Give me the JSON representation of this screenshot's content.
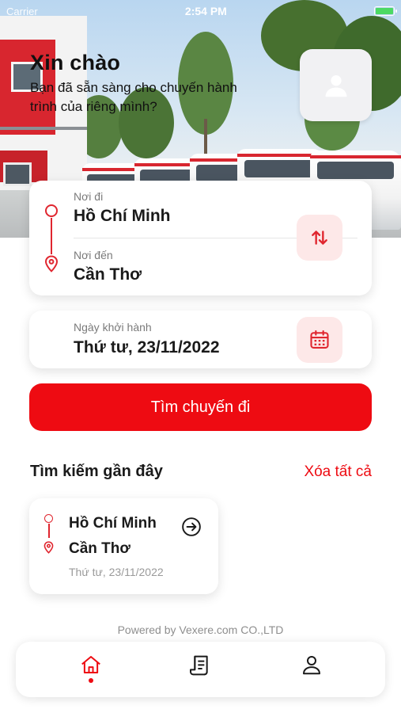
{
  "status_bar": {
    "carrier": "Carrier",
    "time": "2:54 PM"
  },
  "greeting": {
    "title": "Xin chào",
    "subtitle": "Bạn đã sẵn sàng cho chuyến hành trình của riêng mình?"
  },
  "route": {
    "from_label": "Nơi đi",
    "from_value": "Hồ Chí Minh",
    "to_label": "Nơi đến",
    "to_value": "Cần Thơ"
  },
  "departure": {
    "label": "Ngày khởi hành",
    "value": "Thứ tư, 23/11/2022"
  },
  "search_button": {
    "label": "Tìm chuyến đi"
  },
  "recent": {
    "title": "Tìm kiếm gần đây",
    "clear_all": "Xóa tất cả",
    "items": [
      {
        "from": "Hồ Chí Minh",
        "to": "Cần Thơ",
        "date": "Thứ tư, 23/11/2022"
      }
    ]
  },
  "footer": {
    "powered_by": "Powered by Vexere.com CO.,LTD"
  },
  "tabs": [
    {
      "icon": "home-icon",
      "active": true
    },
    {
      "icon": "ticket-icon",
      "active": false
    },
    {
      "icon": "user-icon",
      "active": false
    }
  ],
  "colors": {
    "accent": "#ee0b12",
    "accent_soft": "#fde8e8",
    "route_line": "#e0262f"
  }
}
